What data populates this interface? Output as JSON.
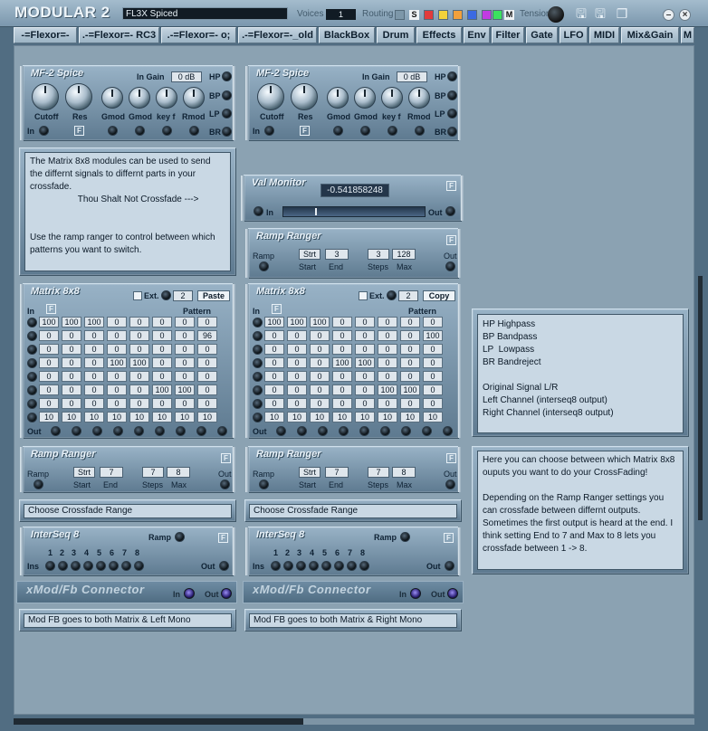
{
  "app": {
    "title": "MODULAR 2",
    "preset": "FL3X Spiced",
    "voices_label": "Voices",
    "voices_value": "1",
    "routing_label": "Routing",
    "routing_letters": [
      "S",
      "M"
    ],
    "routing_colors": [
      "#e23b3b",
      "#f2d23b",
      "#f2a03b",
      "#3b6ae2",
      "#c13be2",
      "#3be25e"
    ],
    "tension_label": "Tension"
  },
  "tabs": [
    "-=Flexor=-",
    ".-=Flexor=- RC3",
    ".-=Flexor=- o;",
    ".-=Flexor=-_old",
    "BlackBox",
    "Drum",
    "Effects",
    "Env",
    "Filter",
    "Gate",
    "LFO",
    "MIDI",
    "Mix&Gain",
    "M"
  ],
  "mf2": {
    "title": "MF-2 Spice",
    "in_gain_label": "In Gain",
    "in_gain_value": "0 dB",
    "modes": [
      "HP",
      "BP",
      "LP",
      "BR"
    ],
    "knobs": [
      "Cutoff",
      "Res",
      "Gmod",
      "Gmod",
      "key f",
      "Rmod"
    ],
    "in_label": "In"
  },
  "notes": {
    "matrix_intro": "The Matrix 8x8 modules can be used to send the differnt signals to differnt parts in your crossfade.\n                   Thou Shalt Not Crossfade --->\n\n\nUse the ramp ranger to control between which patterns you want to switch.",
    "filter_legend": "HP Highpass\nBP Bandpass\nLP  Lowpass\nBR Bandreject\n\nOriginal Signal L/R\nLeft Channel (interseq8 output)\nRight Channel (interseq8 output)",
    "crossfade_help": "Here you can choose between which Matrix 8x8 ouputs you want to do your CrossFading!\n\nDepending on the Ramp Ranger settings you can crossfade between differnt outputs. Sometimes the first output is heard at the end. I think setting End to 7 and Max to 8 lets you crossfade between 1 -> 8.",
    "choose_range": "Choose Crossfade Range",
    "modfb_left": "Mod FB goes to both Matrix & Left Mono",
    "modfb_right": "Mod FB goes to both Matrix & Right Mono"
  },
  "valmonitor": {
    "title": "Val Monitor",
    "value": "-0.541858248",
    "in_label": "In",
    "out_label": "Out",
    "level": 0.23
  },
  "ramp_top": {
    "title": "Ramp Ranger",
    "ramp_label": "Ramp",
    "start_value": "Strt",
    "start_label": "Start",
    "end_value": "3",
    "end_label": "End",
    "steps_value": "3",
    "steps_label": "Steps",
    "max_value": "128",
    "max_label": "Max",
    "out_label": "Out"
  },
  "ramp_lower": {
    "title": "Ramp Ranger",
    "ramp_label": "Ramp",
    "start_value": "Strt",
    "start_label": "Start",
    "end_value": "7",
    "end_label": "End",
    "steps_value": "7",
    "steps_label": "Steps",
    "max_value": "8",
    "max_label": "Max",
    "out_label": "Out"
  },
  "matrix_left": {
    "title": "Matrix 8x8",
    "ext_label": "Ext.",
    "pattern_value": "2",
    "action_label": "Paste",
    "pattern_label": "Pattern",
    "in_label": "In",
    "out_label": "Out",
    "rows": [
      [
        "100",
        "100",
        "100",
        "0",
        "0",
        "0",
        "0",
        "0"
      ],
      [
        "0",
        "0",
        "0",
        "0",
        "0",
        "0",
        "0",
        "96"
      ],
      [
        "0",
        "0",
        "0",
        "0",
        "0",
        "0",
        "0",
        "0"
      ],
      [
        "0",
        "0",
        "0",
        "100",
        "100",
        "0",
        "0",
        "0"
      ],
      [
        "0",
        "0",
        "0",
        "0",
        "0",
        "0",
        "0",
        "0"
      ],
      [
        "0",
        "0",
        "0",
        "0",
        "0",
        "100",
        "100",
        "0"
      ],
      [
        "0",
        "0",
        "0",
        "0",
        "0",
        "0",
        "0",
        "0"
      ],
      [
        "10",
        "10",
        "10",
        "10",
        "10",
        "10",
        "10",
        "10"
      ]
    ]
  },
  "matrix_right": {
    "title": "Matrix 8x8",
    "ext_label": "Ext.",
    "pattern_value": "2",
    "action_label": "Copy",
    "pattern_label": "Pattern",
    "in_label": "In",
    "out_label": "Out",
    "rows": [
      [
        "100",
        "100",
        "100",
        "0",
        "0",
        "0",
        "0",
        "0"
      ],
      [
        "0",
        "0",
        "0",
        "0",
        "0",
        "0",
        "0",
        "100"
      ],
      [
        "0",
        "0",
        "0",
        "0",
        "0",
        "0",
        "0",
        "0"
      ],
      [
        "0",
        "0",
        "0",
        "100",
        "100",
        "0",
        "0",
        "0"
      ],
      [
        "0",
        "0",
        "0",
        "0",
        "0",
        "0",
        "0",
        "0"
      ],
      [
        "0",
        "0",
        "0",
        "0",
        "0",
        "100",
        "100",
        "0"
      ],
      [
        "0",
        "0",
        "0",
        "0",
        "0",
        "0",
        "0",
        "0"
      ],
      [
        "10",
        "10",
        "10",
        "10",
        "10",
        "10",
        "10",
        "10"
      ]
    ]
  },
  "interseq": {
    "title": "InterSeq 8",
    "ramp_label": "Ramp",
    "ins_label": "Ins",
    "out_label": "Out",
    "numbers": [
      "1",
      "2",
      "3",
      "4",
      "5",
      "6",
      "7",
      "8"
    ]
  },
  "xmod": {
    "title": "xMod/Fb Connector",
    "in_label": "In",
    "out_label": "Out"
  }
}
